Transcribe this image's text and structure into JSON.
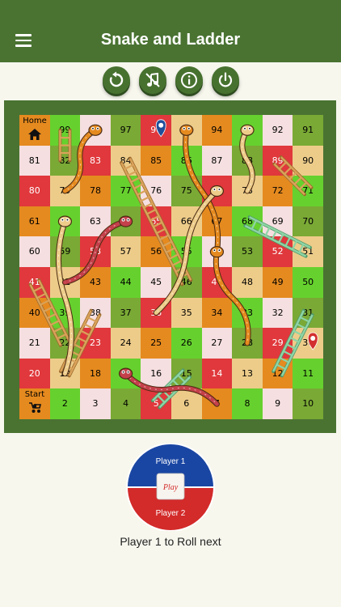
{
  "app": {
    "title": "Snake and Ladder"
  },
  "toolbar": [
    {
      "name": "restart-button",
      "icon": "restart-icon"
    },
    {
      "name": "mute-music-button",
      "icon": "music-off-icon"
    },
    {
      "name": "info-button",
      "icon": "info-icon"
    },
    {
      "name": "power-button",
      "icon": "power-icon"
    }
  ],
  "board": {
    "home_label": "Home",
    "start_label": "Start",
    "cells": [
      [
        "",
        "99",
        "98",
        "97",
        "96",
        "95",
        "94",
        "93",
        "92",
        "91"
      ],
      [
        "81",
        "82",
        "83",
        "84",
        "85",
        "86",
        "87",
        "88",
        "89",
        "90"
      ],
      [
        "80",
        "79",
        "78",
        "77",
        "76",
        "75",
        "74",
        "73",
        "72",
        "71"
      ],
      [
        "61",
        "62",
        "63",
        "64",
        "65",
        "66",
        "67",
        "68",
        "69",
        "70"
      ],
      [
        "60",
        "59",
        "58",
        "57",
        "56",
        "55",
        "54",
        "53",
        "52",
        "51"
      ],
      [
        "41",
        "42",
        "43",
        "44",
        "45",
        "46",
        "47",
        "48",
        "49",
        "50"
      ],
      [
        "40",
        "39",
        "38",
        "37",
        "36",
        "35",
        "34",
        "33",
        "32",
        "31"
      ],
      [
        "21",
        "22",
        "23",
        "24",
        "25",
        "26",
        "27",
        "28",
        "29",
        "30"
      ],
      [
        "20",
        "19",
        "18",
        "17",
        "16",
        "15",
        "14",
        "13",
        "12",
        "11"
      ],
      [
        "",
        "2",
        "3",
        "4",
        "5",
        "6",
        "7",
        "8",
        "9",
        "10"
      ]
    ],
    "cell_colors": [
      [
        "#e58a1f",
        "#66d12e",
        "#f5dfe0",
        "#7aa935",
        "#e0383c",
        "#edcc8a",
        "#e58a1f",
        "#66d12e",
        "#f5dfe0",
        "#7aa935"
      ],
      [
        "#f5dfe0",
        "#7aa935",
        "#e0383c",
        "#edcc8a",
        "#e58a1f",
        "#66d12e",
        "#f5dfe0",
        "#7aa935",
        "#e0383c",
        "#edcc8a"
      ],
      [
        "#e0383c",
        "#edcc8a",
        "#e58a1f",
        "#66d12e",
        "#f5dfe0",
        "#7aa935",
        "#e0383c",
        "#edcc8a",
        "#e58a1f",
        "#66d12e"
      ],
      [
        "#e58a1f",
        "#66d12e",
        "#f5dfe0",
        "#7aa935",
        "#e0383c",
        "#edcc8a",
        "#e58a1f",
        "#66d12e",
        "#f5dfe0",
        "#7aa935"
      ],
      [
        "#f5dfe0",
        "#7aa935",
        "#e0383c",
        "#edcc8a",
        "#e58a1f",
        "#66d12e",
        "#f5dfe0",
        "#7aa935",
        "#e0383c",
        "#edcc8a"
      ],
      [
        "#e0383c",
        "#edcc8a",
        "#e58a1f",
        "#66d12e",
        "#f5dfe0",
        "#7aa935",
        "#e0383c",
        "#edcc8a",
        "#e58a1f",
        "#66d12e"
      ],
      [
        "#e58a1f",
        "#66d12e",
        "#f5dfe0",
        "#7aa935",
        "#e0383c",
        "#edcc8a",
        "#e58a1f",
        "#66d12e",
        "#f5dfe0",
        "#7aa935"
      ],
      [
        "#f5dfe0",
        "#7aa935",
        "#e0383c",
        "#edcc8a",
        "#e58a1f",
        "#66d12e",
        "#f5dfe0",
        "#7aa935",
        "#e0383c",
        "#edcc8a"
      ],
      [
        "#e0383c",
        "#edcc8a",
        "#e58a1f",
        "#66d12e",
        "#f5dfe0",
        "#7aa935",
        "#e0383c",
        "#edcc8a",
        "#e58a1f",
        "#66d12e"
      ],
      [
        "#e58a1f",
        "#66d12e",
        "#f5dfe0",
        "#7aa935",
        "#e0383c",
        "#edcc8a",
        "#e58a1f",
        "#66d12e",
        "#f5dfe0",
        "#7aa935"
      ]
    ],
    "ladders": [
      {
        "from": "82",
        "to": "99",
        "color": "#d9a25a"
      },
      {
        "from": "51",
        "to": "68",
        "color": "#8ed4a5"
      },
      {
        "from": "46",
        "to": "84",
        "color": "#d9a25a"
      },
      {
        "from": "22",
        "to": "41",
        "color": "#d9a25a"
      },
      {
        "from": "19",
        "to": "38",
        "color": "#d9a25a"
      },
      {
        "from": "12",
        "to": "31",
        "color": "#8ed4a5"
      },
      {
        "from": "5",
        "to": "15",
        "color": "#8ed4a5"
      },
      {
        "from": "89",
        "to": "71",
        "color": "#d9a25a"
      }
    ],
    "snakes": [
      {
        "head": "98",
        "tail": "79",
        "color": "#e58a1f"
      },
      {
        "head": "95",
        "tail": "54",
        "color": "#e58a1f"
      },
      {
        "head": "74",
        "tail": "36",
        "color": "#edcc8a"
      },
      {
        "head": "93",
        "tail": "73",
        "color": "#edcc8a"
      },
      {
        "head": "62",
        "tail": "19",
        "color": "#edcc8a"
      },
      {
        "head": "64",
        "tail": "42",
        "color": "#c4404a"
      },
      {
        "head": "54",
        "tail": "28",
        "color": "#e58a1f"
      },
      {
        "head": "17",
        "tail": "7",
        "color": "#c4404a"
      }
    ],
    "tokens": [
      {
        "player": "Player 1",
        "cell": "96",
        "color": "#1f4e9a"
      },
      {
        "player": "Player 2",
        "cell": "30",
        "color": "#d32f2f"
      }
    ]
  },
  "legend": {
    "player1": "Player 1",
    "player2": "Player 2",
    "play": "Play",
    "player1_color": "#1a46a3",
    "player2_color": "#d32a2a"
  },
  "status": {
    "text": "Player 1 to Roll next"
  }
}
